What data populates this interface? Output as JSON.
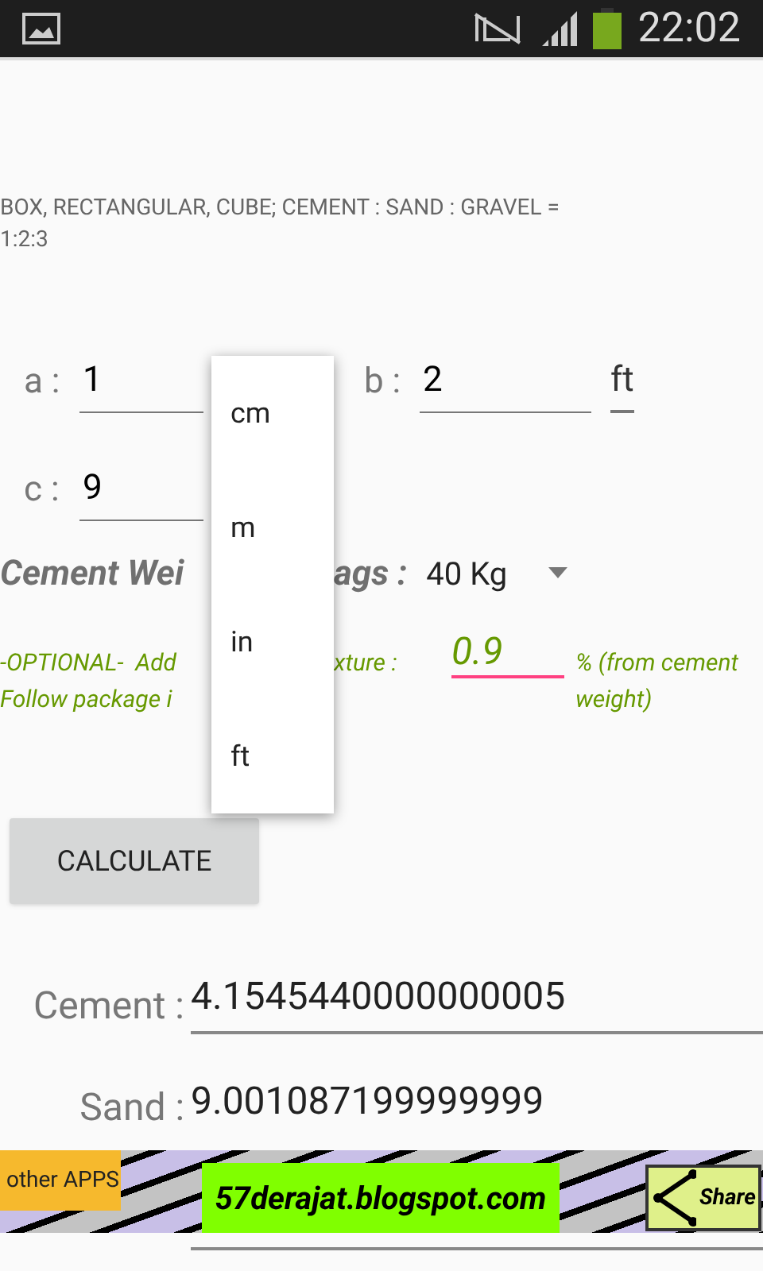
{
  "status_bar": {
    "time": "22:02"
  },
  "description": "BOX, RECTANGULAR, CUBE; CEMENT : SAND : GRAVEL = 1:2:3",
  "dimension_rows": [
    [
      {
        "label": "a :",
        "value": "1"
      },
      {
        "label": "b :",
        "value": "2",
        "unit": "ft"
      }
    ],
    [
      {
        "label": "c :",
        "value": "9"
      }
    ]
  ],
  "cement_weight": {
    "label_parts": [
      "Cement Wei",
      "ags :"
    ],
    "value": "40 Kg"
  },
  "admixture": {
    "lines": [
      [
        "-OPTIONAL-  Add",
        "xture :"
      ],
      [
        "Follow package i"
      ]
    ],
    "value": "0.9",
    "suffix": "% (from cement weight)"
  },
  "calculate_button": "CALCULATE",
  "results": [
    {
      "label": "Cement :",
      "value": "4.1545440000000005"
    },
    {
      "label": "Sand :",
      "value": "9.001087199999999"
    }
  ],
  "unit_menu": {
    "options": [
      "cm",
      "m",
      "in",
      "ft"
    ]
  },
  "banner": {
    "other_apps": "other APPS",
    "site": "57derajat.blogspot.com",
    "share": "Share"
  }
}
